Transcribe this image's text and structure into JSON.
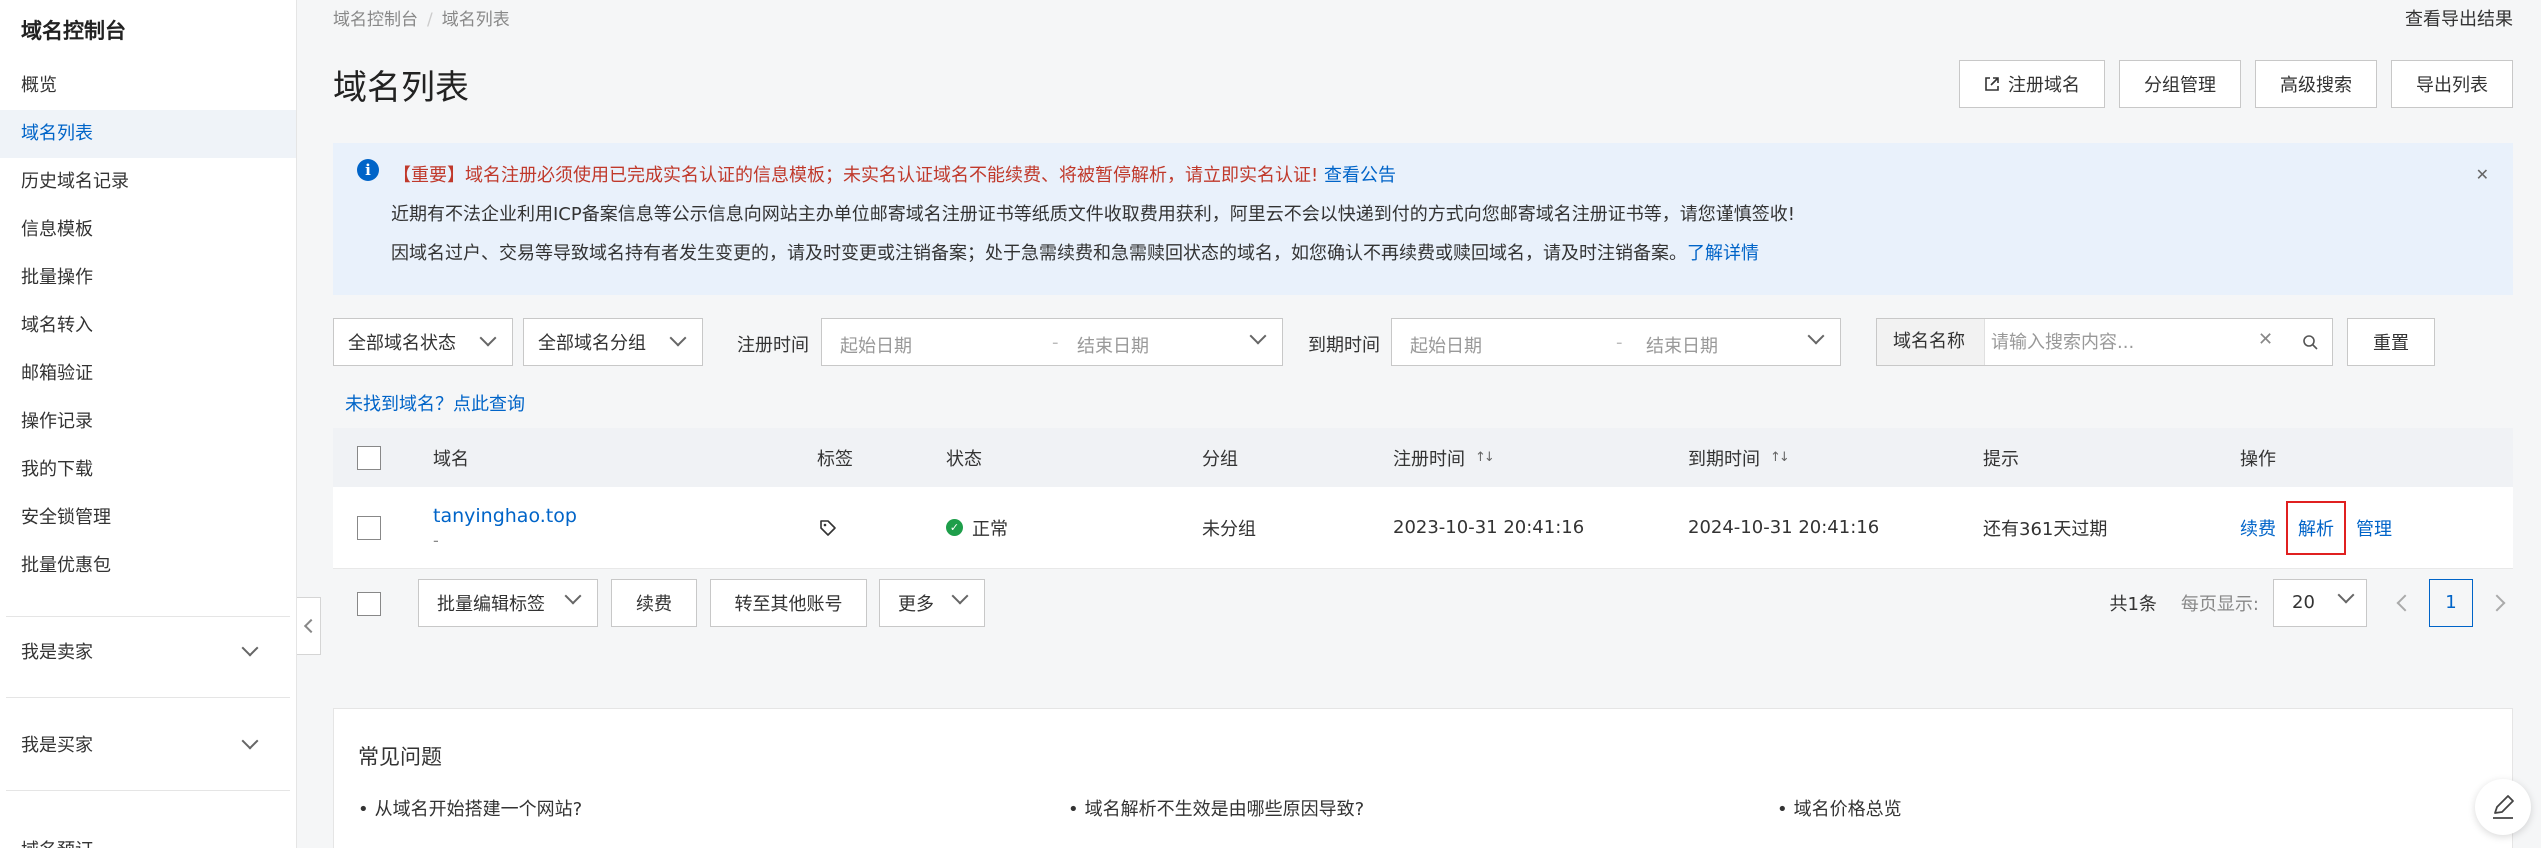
{
  "sidebar": {
    "title": "域名控制台",
    "items": [
      {
        "label": "概览"
      },
      {
        "label": "域名列表"
      },
      {
        "label": "历史域名记录"
      },
      {
        "label": "信息模板"
      },
      {
        "label": "批量操作"
      },
      {
        "label": "域名转入"
      },
      {
        "label": "邮箱验证"
      },
      {
        "label": "操作记录"
      },
      {
        "label": "我的下载"
      },
      {
        "label": "安全锁管理"
      },
      {
        "label": "批量优惠包"
      }
    ],
    "groups": [
      {
        "label": "我是卖家"
      },
      {
        "label": "我是买家"
      }
    ],
    "cut_item": "域名预订"
  },
  "breadcrumb": {
    "root": "域名控制台",
    "current": "域名列表"
  },
  "export_results": "查看导出结果",
  "page_title": "域名列表",
  "actions": {
    "register": "注册域名",
    "group_manage": "分组管理",
    "advanced_search": "高级搜索",
    "export_list": "导出列表"
  },
  "notice": {
    "line1_warn": "【重要】域名注册必须使用已完成实名认证的信息模板；未实名认证域名不能续费、将被暂停解析，请立即实名认证!",
    "line1_link": "查看公告",
    "line2": "近期有不法企业利用ICP备案信息等公示信息向网站主办单位邮寄域名注册证书等纸质文件收取费用获利，阿里云不会以快递到付的方式向您邮寄域名注册证书等，请您谨慎签收!",
    "line3": "因域名过户、交易等导致域名持有者发生变更的，请及时变更或注销备案；处于急需续费和急需赎回状态的域名，如您确认不再续费或赎回域名，请及时注销备案。",
    "line3_link": "了解详情"
  },
  "filters": {
    "status": "全部域名状态",
    "group": "全部域名分组",
    "reg_time_label": "注册时间",
    "exp_time_label": "到期时间",
    "start_date": "起始日期",
    "end_date": "结束日期",
    "name_label": "域名名称",
    "search_placeholder": "请输入搜索内容...",
    "reset": "重置"
  },
  "not_found_link": "未找到域名？点此查询",
  "table": {
    "headers": {
      "domain": "域名",
      "tag": "标签",
      "status": "状态",
      "group": "分组",
      "reg_time": "注册时间",
      "exp_time": "到期时间",
      "hint": "提示",
      "ops": "操作"
    },
    "rows": [
      {
        "domain": "tanyinghao.top",
        "sub": "-",
        "status": "正常",
        "group": "未分组",
        "reg_time": "2023-10-31 20:41:16",
        "exp_time": "2024-10-31 20:41:16",
        "hint": "还有361天过期",
        "op_renew": "续费",
        "op_resolve": "解析",
        "op_manage": "管理"
      }
    ]
  },
  "bulk": {
    "edit_tags": "批量编辑标签",
    "renew": "续费",
    "transfer": "转至其他账号",
    "more": "更多"
  },
  "pager": {
    "total": "共1条",
    "per_page_label": "每页显示:",
    "per_page": "20",
    "current": "1"
  },
  "faq": {
    "title": "常见问题",
    "items": [
      {
        "label": "从域名开始搭建一个网站?"
      },
      {
        "label": "域名解析不生效是由哪些原因导致?"
      },
      {
        "label": "域名价格总览"
      }
    ]
  },
  "colors": {
    "accent": "#0064c8",
    "warn": "#c0392b",
    "success": "#1e9e4a",
    "highlight": "#e02020"
  }
}
